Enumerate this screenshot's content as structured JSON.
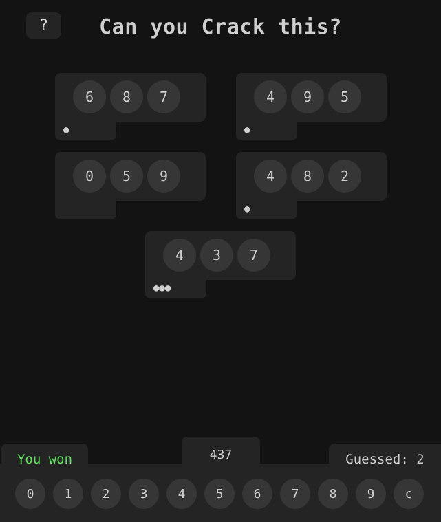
{
  "help": {
    "label": "?"
  },
  "title": "Can you Crack this?",
  "clues": [
    {
      "digits": [
        "6",
        "8",
        "7"
      ],
      "dots": "●"
    },
    {
      "digits": [
        "4",
        "9",
        "5"
      ],
      "dots": "●"
    },
    {
      "digits": [
        "0",
        "5",
        "9"
      ],
      "dots": ""
    },
    {
      "digits": [
        "4",
        "8",
        "2"
      ],
      "dots": "●"
    },
    {
      "digits": [
        "4",
        "3",
        "7"
      ],
      "dots": "●●●"
    }
  ],
  "status": "You won",
  "current_guess": "437",
  "guessed": "Guessed: 2",
  "keypad": [
    "0",
    "1",
    "2",
    "3",
    "4",
    "5",
    "6",
    "7",
    "8",
    "9",
    "c"
  ],
  "colors": {
    "background": "#131313",
    "panel": "#242424",
    "circle": "#363636",
    "win": "#5fe35f"
  }
}
